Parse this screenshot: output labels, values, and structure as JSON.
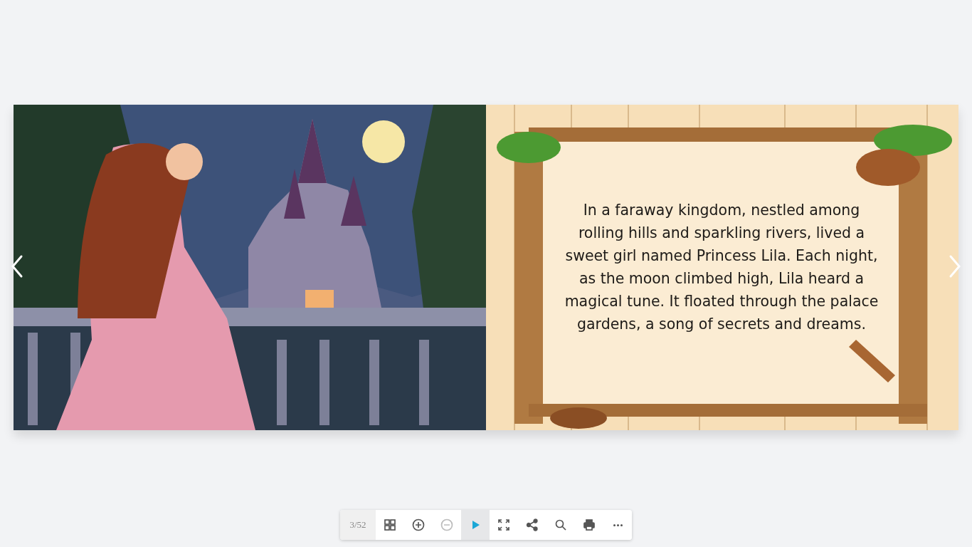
{
  "book": {
    "right_page": {
      "kind": "picture",
      "text": "In a faraway kingdom, nestled among rolling hills and sparkling rivers, lived a sweet girl named Princess Lila. Each night, as the moon climbed high, Lila heard a magical tune. It floated through the palace gardens, a song of secrets and dreams."
    }
  },
  "toolbar": {
    "page_counter": "3/52",
    "buttons": [
      {
        "kind": "thumbnails",
        "disabled": false,
        "selected": false
      },
      {
        "kind": "zoom-in",
        "disabled": false,
        "selected": false
      },
      {
        "kind": "zoom-out",
        "disabled": true,
        "selected": false
      },
      {
        "kind": "play",
        "disabled": false,
        "selected": true
      },
      {
        "kind": "fullscreen",
        "disabled": false,
        "selected": false
      },
      {
        "kind": "share",
        "disabled": false,
        "selected": false
      },
      {
        "kind": "search",
        "disabled": false,
        "selected": false
      },
      {
        "kind": "print",
        "disabled": false,
        "selected": false
      },
      {
        "kind": "more",
        "disabled": false,
        "selected": false
      }
    ]
  }
}
